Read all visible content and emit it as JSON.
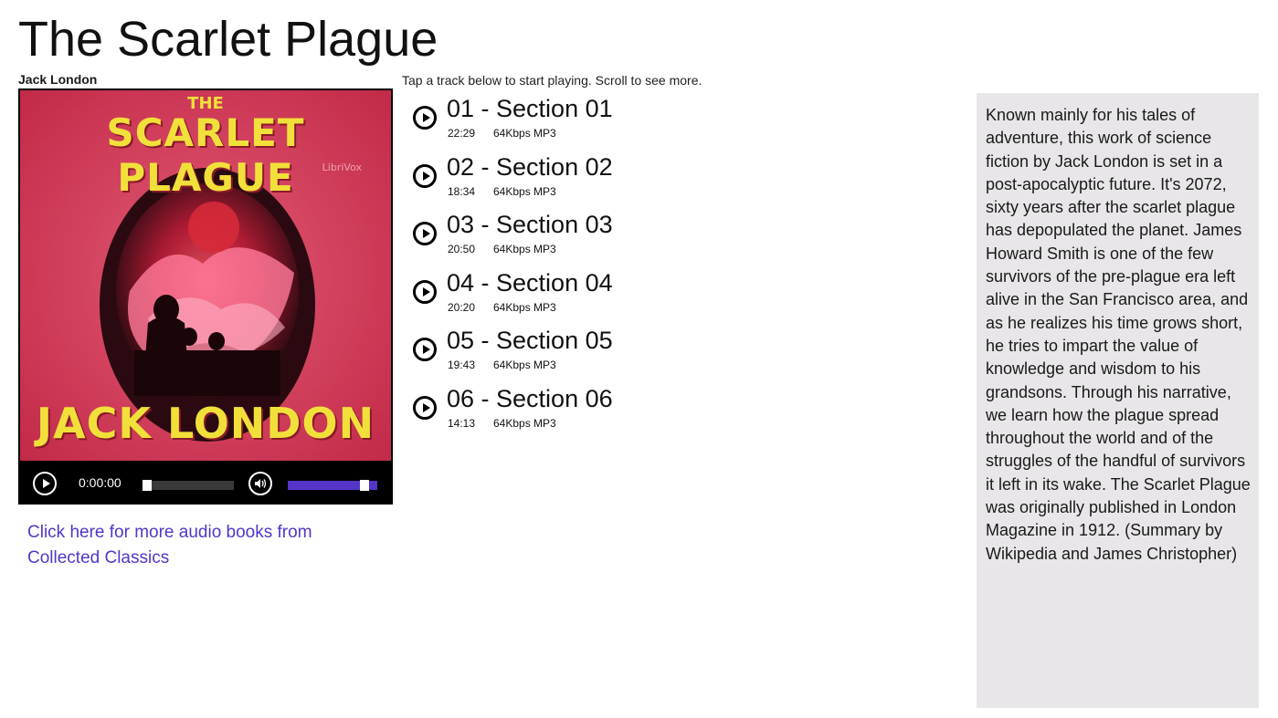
{
  "book": {
    "title": "The Scarlet Plague",
    "author": "Jack London"
  },
  "cover": {
    "top_text": "THE",
    "title_text": "SCARLET PLAGUE",
    "publisher_text": "LibriVox",
    "author_text": "JACK LONDON",
    "colors": {
      "background": "#d23a57",
      "lettering": "#f2e03a",
      "oval": "#2a0a10"
    }
  },
  "player": {
    "time": "0:00:00",
    "progress": 0.0,
    "volume": 0.9,
    "accent_color": "#5535c8"
  },
  "more_link": {
    "label": "Click here for more audio books from Collected Classics"
  },
  "tracks_section": {
    "instruction": "Tap a track below to start playing. Scroll to see more.",
    "items": [
      {
        "title": "01 - Section 01",
        "duration": "22:29",
        "format": "64Kbps MP3"
      },
      {
        "title": "02 - Section 02",
        "duration": "18:34",
        "format": "64Kbps MP3"
      },
      {
        "title": "03 - Section 03",
        "duration": "20:50",
        "format": "64Kbps MP3"
      },
      {
        "title": "04 - Section 04",
        "duration": "20:20",
        "format": "64Kbps MP3"
      },
      {
        "title": "05 - Section 05",
        "duration": "19:43",
        "format": "64Kbps MP3"
      },
      {
        "title": "06 - Section 06",
        "duration": "14:13",
        "format": "64Kbps MP3"
      }
    ]
  },
  "description": {
    "text": "Known mainly for his tales of adventure, this work of science fiction by Jack London is set in a post-apocalyptic future. It's 2072, sixty years after the scarlet plague has depopulated the planet. James Howard Smith is one of the few survivors of the pre-plague era left alive in the San Francisco area, and as he realizes his time grows short, he tries to impart the value of knowledge and wisdom to his grandsons. Through his narrative, we learn how the plague spread throughout the world and of the struggles of the handful of survivors it left in its wake. The Scarlet Plague was originally published in London Magazine in 1912. (Summary by Wikipedia and James Christopher)"
  }
}
